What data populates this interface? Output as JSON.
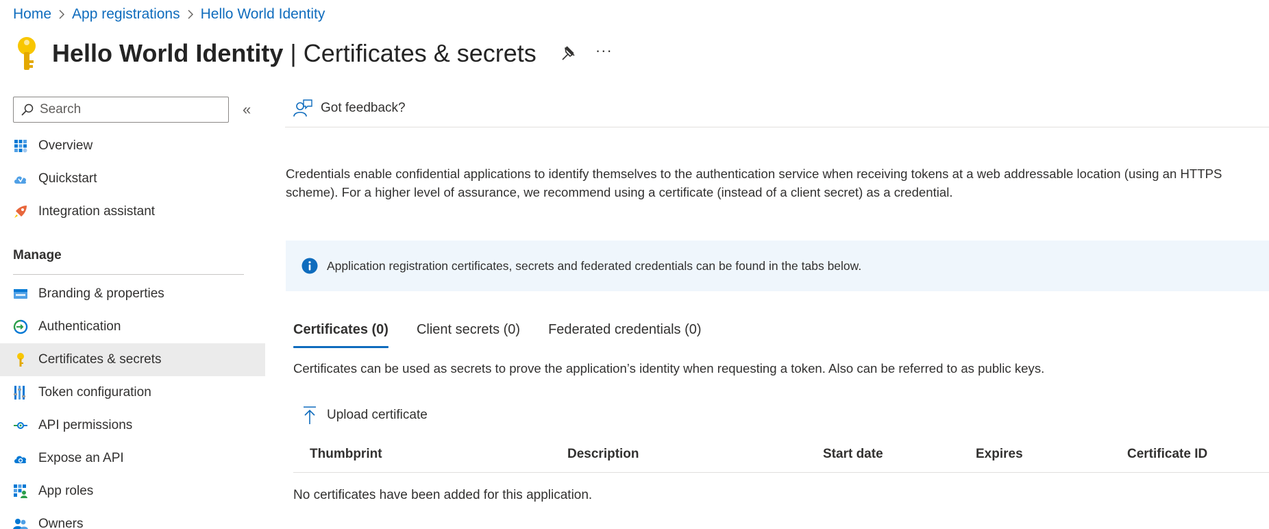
{
  "breadcrumb": {
    "items": [
      "Home",
      "App registrations",
      "Hello World Identity"
    ]
  },
  "page": {
    "app_name": "Hello World Identity",
    "separator": " | ",
    "section_title": "Certificates & secrets",
    "more_label": "···"
  },
  "sidebar": {
    "search_placeholder": "Search",
    "collapse_glyph": "«",
    "top_items": [
      {
        "label": "Overview",
        "icon": "overview-grid-icon"
      },
      {
        "label": "Quickstart",
        "icon": "quickstart-cloud-icon"
      },
      {
        "label": "Integration assistant",
        "icon": "rocket-icon"
      }
    ],
    "group_heading": "Manage",
    "manage_items": [
      {
        "label": "Branding & properties",
        "icon": "branding-icon"
      },
      {
        "label": "Authentication",
        "icon": "authentication-icon"
      },
      {
        "label": "Certificates & secrets",
        "icon": "key-icon",
        "active": true
      },
      {
        "label": "Token configuration",
        "icon": "token-bars-icon"
      },
      {
        "label": "API permissions",
        "icon": "api-permissions-icon"
      },
      {
        "label": "Expose an API",
        "icon": "cloud-api-icon"
      },
      {
        "label": "App roles",
        "icon": "app-roles-icon"
      },
      {
        "label": "Owners",
        "icon": "owners-icon"
      }
    ]
  },
  "commandbar": {
    "feedback_label": "Got feedback?"
  },
  "intro_text": "Credentials enable confidential applications to identify themselves to the authentication service when receiving tokens at a web addressable location (using an HTTPS scheme). For a higher level of assurance, we recommend using a certificate (instead of a client secret) as a credential.",
  "info_banner": "Application registration certificates, secrets and federated credentials can be found in the tabs below.",
  "tabs": [
    {
      "label": "Certificates (0)",
      "selected": true
    },
    {
      "label": "Client secrets (0)",
      "selected": false
    },
    {
      "label": "Federated credentials (0)",
      "selected": false
    }
  ],
  "tab_description": "Certificates can be used as secrets to prove the application’s identity when requesting a token. Also can be referred to as public keys.",
  "upload_label": "Upload certificate",
  "table": {
    "columns": [
      "Thumbprint",
      "Description",
      "Start date",
      "Expires",
      "Certificate ID"
    ],
    "empty_message": "No certificates have been added for this application."
  },
  "colors": {
    "link": "#0f6cbd",
    "info_bg": "#eff6fc",
    "info_icon": "#0f6cbd",
    "active_nav_bg": "#ebebeb",
    "key_yellow": "#f8c600"
  }
}
